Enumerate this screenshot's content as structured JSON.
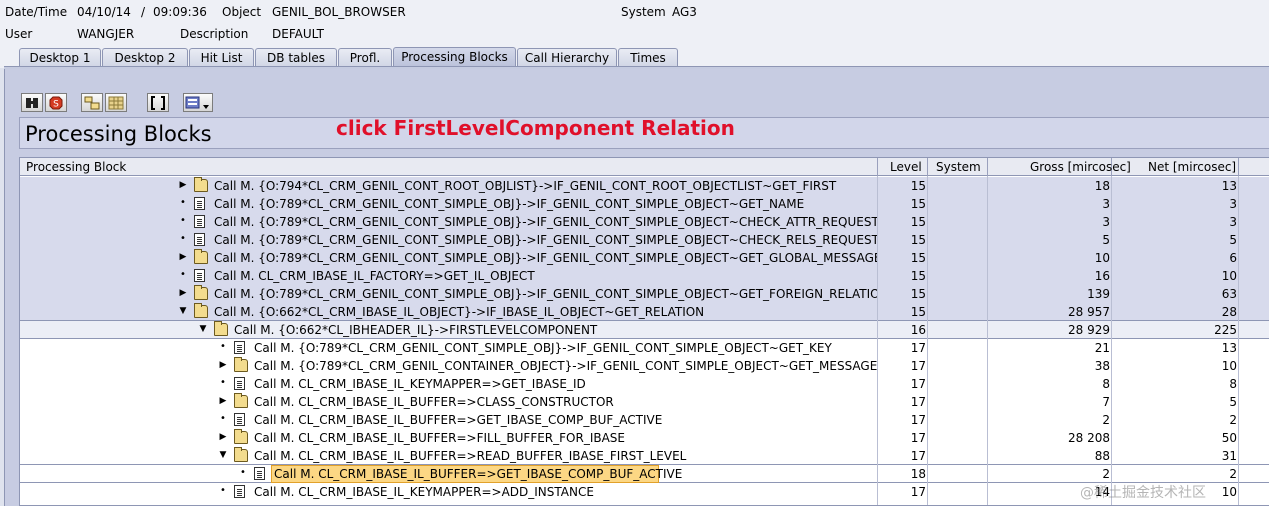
{
  "header": {
    "datetime_label": "Date/Time",
    "date": "04/10/14",
    "time_sep": "/",
    "time": "09:09:36",
    "object_label": "Object",
    "object_value": "GENIL_BOL_BROWSER",
    "system_label": "System",
    "system_value": "AG3",
    "user_label": "User",
    "user_value": "WANGJER",
    "description_label": "Description",
    "description_value": "DEFAULT"
  },
  "tabs": [
    "Desktop 1",
    "Desktop 2",
    "Hit List",
    "DB tables",
    "Profl.",
    "Processing Blocks",
    "Call Hierarchy",
    "Times"
  ],
  "active_tab": "Processing Blocks",
  "toolbar": {
    "icons": [
      "find-icon",
      "stop-icon",
      "expand-icon",
      "collapse-icon",
      "brackets-icon",
      "layout-icon"
    ]
  },
  "title": "Processing Blocks",
  "annotation": "click FirstLevelComponent Relation",
  "columns": {
    "block": "Processing Block",
    "level": "Level",
    "system": "System",
    "gross": "Gross [mircosec]",
    "net": "Net [mircosec]"
  },
  "rows": [
    {
      "indent": 0,
      "arrow": "▶",
      "icon": "folder",
      "text": "Call M. {O:794*CL_CRM_GENIL_CONT_ROOT_OBJLIST}->IF_GENIL_CONT_ROOT_OBJECTLIST~GET_FIRST",
      "level": "15",
      "gross": "18",
      "net": "13"
    },
    {
      "indent": 0,
      "arrow": "•",
      "icon": "doc",
      "text": "Call M. {O:789*CL_CRM_GENIL_CONT_SIMPLE_OBJ}->IF_GENIL_CONT_SIMPLE_OBJECT~GET_NAME",
      "level": "15",
      "gross": "3",
      "net": "3"
    },
    {
      "indent": 0,
      "arrow": "•",
      "icon": "doc",
      "text": "Call M. {O:789*CL_CRM_GENIL_CONT_SIMPLE_OBJ}->IF_GENIL_CONT_SIMPLE_OBJECT~CHECK_ATTR_REQUESTED",
      "level": "15",
      "gross": "3",
      "net": "3"
    },
    {
      "indent": 0,
      "arrow": "•",
      "icon": "doc",
      "text": "Call M. {O:789*CL_CRM_GENIL_CONT_SIMPLE_OBJ}->IF_GENIL_CONT_SIMPLE_OBJECT~CHECK_RELS_REQUESTED",
      "level": "15",
      "gross": "5",
      "net": "5"
    },
    {
      "indent": 0,
      "arrow": "▶",
      "icon": "folder",
      "text": "Call M. {O:789*CL_CRM_GENIL_CONT_SIMPLE_OBJ}->IF_GENIL_CONT_SIMPLE_OBJECT~GET_GLOBAL_MESSAGE_CONT",
      "level": "15",
      "gross": "10",
      "net": "6"
    },
    {
      "indent": 0,
      "arrow": "•",
      "icon": "doc",
      "text": "Call M. CL_CRM_IBASE_IL_FACTORY=>GET_IL_OBJECT",
      "level": "15",
      "gross": "16",
      "net": "10"
    },
    {
      "indent": 0,
      "arrow": "▶",
      "icon": "folder",
      "text": "Call M. {O:789*CL_CRM_GENIL_CONT_SIMPLE_OBJ}->IF_GENIL_CONT_SIMPLE_OBJECT~GET_FOREIGN_RELATIONS",
      "level": "15",
      "gross": "139",
      "net": "63"
    },
    {
      "indent": 0,
      "arrow": "▼",
      "icon": "folder",
      "text": "Call M. {O:662*CL_CRM_IBASE_IL_OBJECT}->IF_IBASE_IL_OBJECT~GET_RELATION",
      "level": "15",
      "gross": "28 957",
      "net": "28"
    },
    {
      "indent": 1,
      "arrow": "▼",
      "icon": "folder",
      "text": "Call M. {O:662*CL_IBHEADER_IL}->FIRSTLEVELCOMPONENT",
      "level": "16",
      "gross": "28 929",
      "net": "225"
    },
    {
      "indent": 2,
      "arrow": "•",
      "icon": "doc",
      "text": "Call M. {O:789*CL_CRM_GENIL_CONT_SIMPLE_OBJ}->IF_GENIL_CONT_SIMPLE_OBJECT~GET_KEY",
      "level": "17",
      "gross": "21",
      "net": "13"
    },
    {
      "indent": 2,
      "arrow": "▶",
      "icon": "folder",
      "text": "Call M. {O:789*CL_CRM_GENIL_CONTAINER_OBJECT}->IF_GENIL_CONT_SIMPLE_OBJECT~GET_MESSAGE_CONT",
      "level": "17",
      "gross": "38",
      "net": "10"
    },
    {
      "indent": 2,
      "arrow": "•",
      "icon": "doc",
      "text": "Call M. CL_CRM_IBASE_IL_KEYMAPPER=>GET_IBASE_ID",
      "level": "17",
      "gross": "8",
      "net": "8"
    },
    {
      "indent": 2,
      "arrow": "▶",
      "icon": "folder",
      "text": "Call M. CL_CRM_IBASE_IL_BUFFER=>CLASS_CONSTRUCTOR",
      "level": "17",
      "gross": "7",
      "net": "5"
    },
    {
      "indent": 2,
      "arrow": "•",
      "icon": "doc",
      "text": "Call M. CL_CRM_IBASE_IL_BUFFER=>GET_IBASE_COMP_BUF_ACTIVE",
      "level": "17",
      "gross": "2",
      "net": "2"
    },
    {
      "indent": 2,
      "arrow": "▶",
      "icon": "folder",
      "text": "Call M. CL_CRM_IBASE_IL_BUFFER=>FILL_BUFFER_FOR_IBASE",
      "level": "17",
      "gross": "28 208",
      "net": "50"
    },
    {
      "indent": 2,
      "arrow": "▼",
      "icon": "folder",
      "text": "Call M. CL_CRM_IBASE_IL_BUFFER=>READ_BUFFER_IBASE_FIRST_LEVEL",
      "level": "17",
      "gross": "88",
      "net": "31"
    },
    {
      "indent": 3,
      "arrow": "•",
      "icon": "doc",
      "text": "Call M. CL_CRM_IBASE_IL_BUFFER=>GET_IBASE_COMP_BUF_ACTIVE",
      "level": "18",
      "gross": "2",
      "net": "2",
      "selected": true
    },
    {
      "indent": 2,
      "arrow": "•",
      "icon": "doc",
      "text": "Call M. CL_CRM_IBASE_IL_KEYMAPPER=>ADD_INSTANCE",
      "level": "17",
      "gross": "14",
      "net": "10"
    }
  ],
  "watermark": "@稀土掘金技术社区"
}
